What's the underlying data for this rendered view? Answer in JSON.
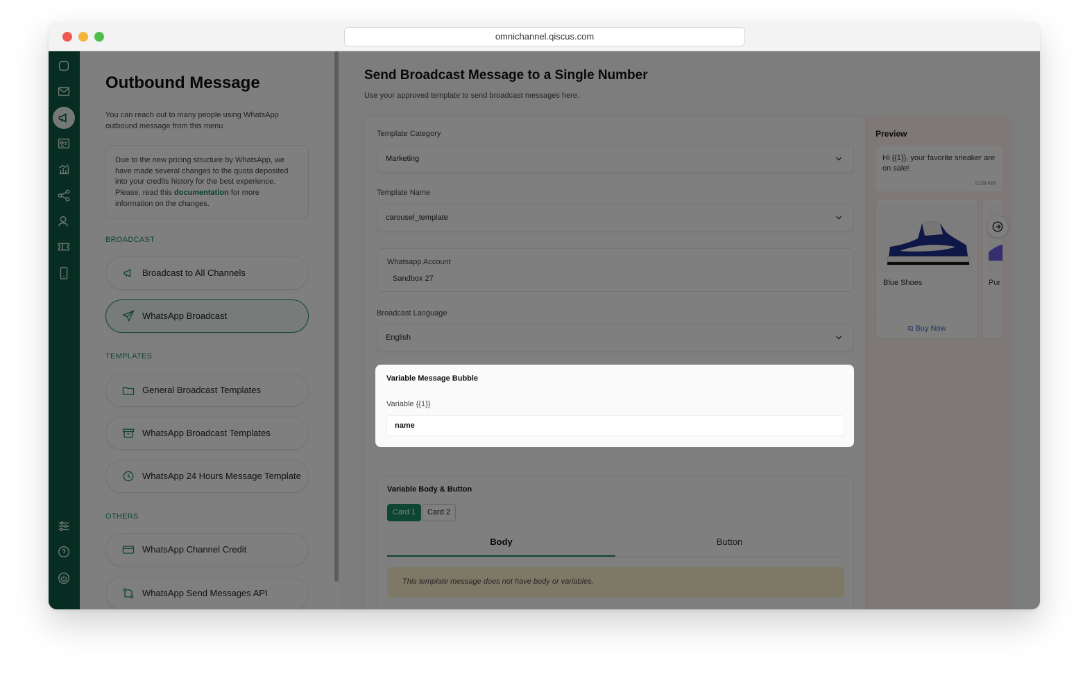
{
  "browser": {
    "url": "omnichannel.qiscus.com",
    "traffic_colors": [
      "#ee5a52",
      "#f5b53a",
      "#4fbe4a"
    ]
  },
  "rail": {
    "icons": [
      "chat-icon",
      "mail-icon",
      "broadcast-icon",
      "contact-card-icon",
      "analytics-icon",
      "share-nodes-icon",
      "user-icon",
      "ticket-icon",
      "mobile-icon",
      "settings-sliders-icon",
      "help-icon",
      "power-icon"
    ],
    "accent": "#0f5b45"
  },
  "left": {
    "title": "Outbound Message",
    "description": "You can reach out to many people using WhatsApp outbound message from this menu",
    "notice_before": "Due to the new pricing structure by WhatsApp, we have made several changes to the quota deposited into your credits history for the best experience. Please, read this ",
    "notice_link": "documentation",
    "notice_after": " for more information on the changes.",
    "sections": {
      "broadcast": "BROADCAST",
      "templates": "TEMPLATES",
      "others": "OTHERS"
    },
    "items": [
      {
        "label": "Broadcast to All Channels",
        "icon": "megaphone-icon"
      },
      {
        "label": "WhatsApp Broadcast",
        "icon": "send-icon"
      },
      {
        "label": "General Broadcast Templates",
        "icon": "folder-icon"
      },
      {
        "label": "WhatsApp Broadcast Templates",
        "icon": "archive-icon"
      },
      {
        "label": "WhatsApp 24 Hours Message Template",
        "icon": "clock-icon"
      },
      {
        "label": "WhatsApp Channel Credit",
        "icon": "credit-card-icon"
      },
      {
        "label": "WhatsApp Send Messages API",
        "icon": "api-icon"
      }
    ]
  },
  "main": {
    "title": "Send Broadcast Message to a Single Number",
    "subtitle": "Use your approved template to send broadcast messages here.",
    "template_category_label": "Template Category",
    "template_category_value": "Marketing",
    "template_name_label": "Template Name",
    "template_name_value": "carousel_template",
    "whatsapp_account_label": "Whatsapp Account",
    "whatsapp_account_value": "Sandbox 27",
    "language_label": "Broadcast Language",
    "language_value": "English",
    "variable_bubble": {
      "title": "Variable Message Bubble",
      "variable_label": "Variable {{1}}",
      "variable_value": "name"
    },
    "variable_body": {
      "title": "Variable Body & Button",
      "cards": [
        "Card 1",
        "Card 2"
      ],
      "tabs": [
        "Body",
        "Button"
      ],
      "empty_notice": "This template message does not have body or variables."
    }
  },
  "preview": {
    "title": "Preview",
    "bubble_text": "Hi {{1}}, your favorite sneaker are on sale!",
    "bubble_time": "5:09 AM",
    "cards": [
      {
        "name": "Blue Shoes",
        "button": "Buy Now"
      },
      {
        "name": "Pur"
      }
    ]
  },
  "colors": {
    "accent_green": "#1f8a66",
    "link_blue": "#2a6fc4",
    "warning_bg": "#fdf3cf"
  }
}
